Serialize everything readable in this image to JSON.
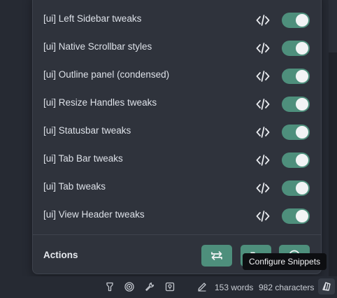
{
  "snippets": [
    {
      "label": "[ui] Left Sidebar tweaks",
      "enabled": true
    },
    {
      "label": "[ui] Native Scrollbar styles",
      "enabled": true
    },
    {
      "label": "[ui] Outline panel (condensed)",
      "enabled": true
    },
    {
      "label": "[ui] Resize Handles tweaks",
      "enabled": true
    },
    {
      "label": "[ui] Statusbar tweaks",
      "enabled": true
    },
    {
      "label": "[ui] Tab Bar tweaks",
      "enabled": true
    },
    {
      "label": "[ui] Tab tweaks",
      "enabled": true
    },
    {
      "label": "[ui] View Header tweaks",
      "enabled": true
    }
  ],
  "actions": {
    "label": "Actions",
    "buttons": [
      {
        "icon": "reload-icon"
      },
      {
        "icon": "folder-icon"
      },
      {
        "icon": "compass-icon"
      }
    ]
  },
  "statusbar": {
    "word_count": "153 words",
    "char_count": "982 characters"
  },
  "tooltip": {
    "text": "Configure Snippets"
  },
  "colors": {
    "accent": "#4e8f7c",
    "panel": "#2f333c",
    "background": "#262a33",
    "tooltip": "#0d0e11"
  }
}
